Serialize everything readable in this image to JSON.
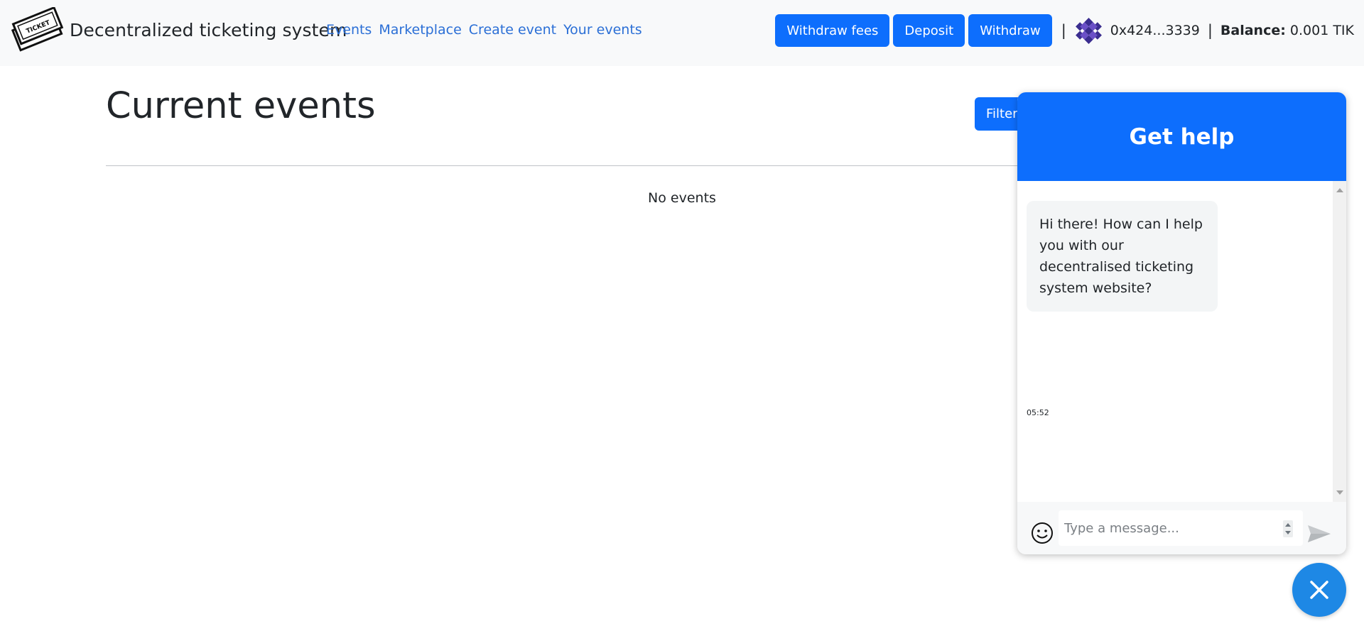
{
  "navbar": {
    "brand_text": "Decentralized ticketing system",
    "logo_text": "TICKET",
    "links": [
      "Events",
      "Marketplace",
      "Create event",
      "Your events"
    ],
    "buttons": {
      "withdraw_fees": "Withdraw fees",
      "deposit": "Deposit",
      "withdraw": "Withdraw"
    },
    "separator": "|",
    "address": "0x424...3339",
    "balance_label": "Balance:",
    "balance_value": "0.001 TIK"
  },
  "main": {
    "title": "Current events",
    "filter_label": "Filter",
    "empty_message": "No events"
  },
  "chat": {
    "title": "Get help",
    "message": "Hi there! How can I help you with our decentralised ticketing system website?",
    "time": "05:52",
    "input_placeholder": "Type a message..."
  },
  "icons": {
    "logo": "ticket-logo-icon",
    "avatar": "identicon-avatar",
    "emoji": "smiley-icon",
    "send": "send-icon",
    "close": "close-icon"
  },
  "colors": {
    "primary": "#0d6efd",
    "nav_bg": "#f8f9fa",
    "link": "#2b6fd6",
    "fab": "#1e88e5"
  }
}
